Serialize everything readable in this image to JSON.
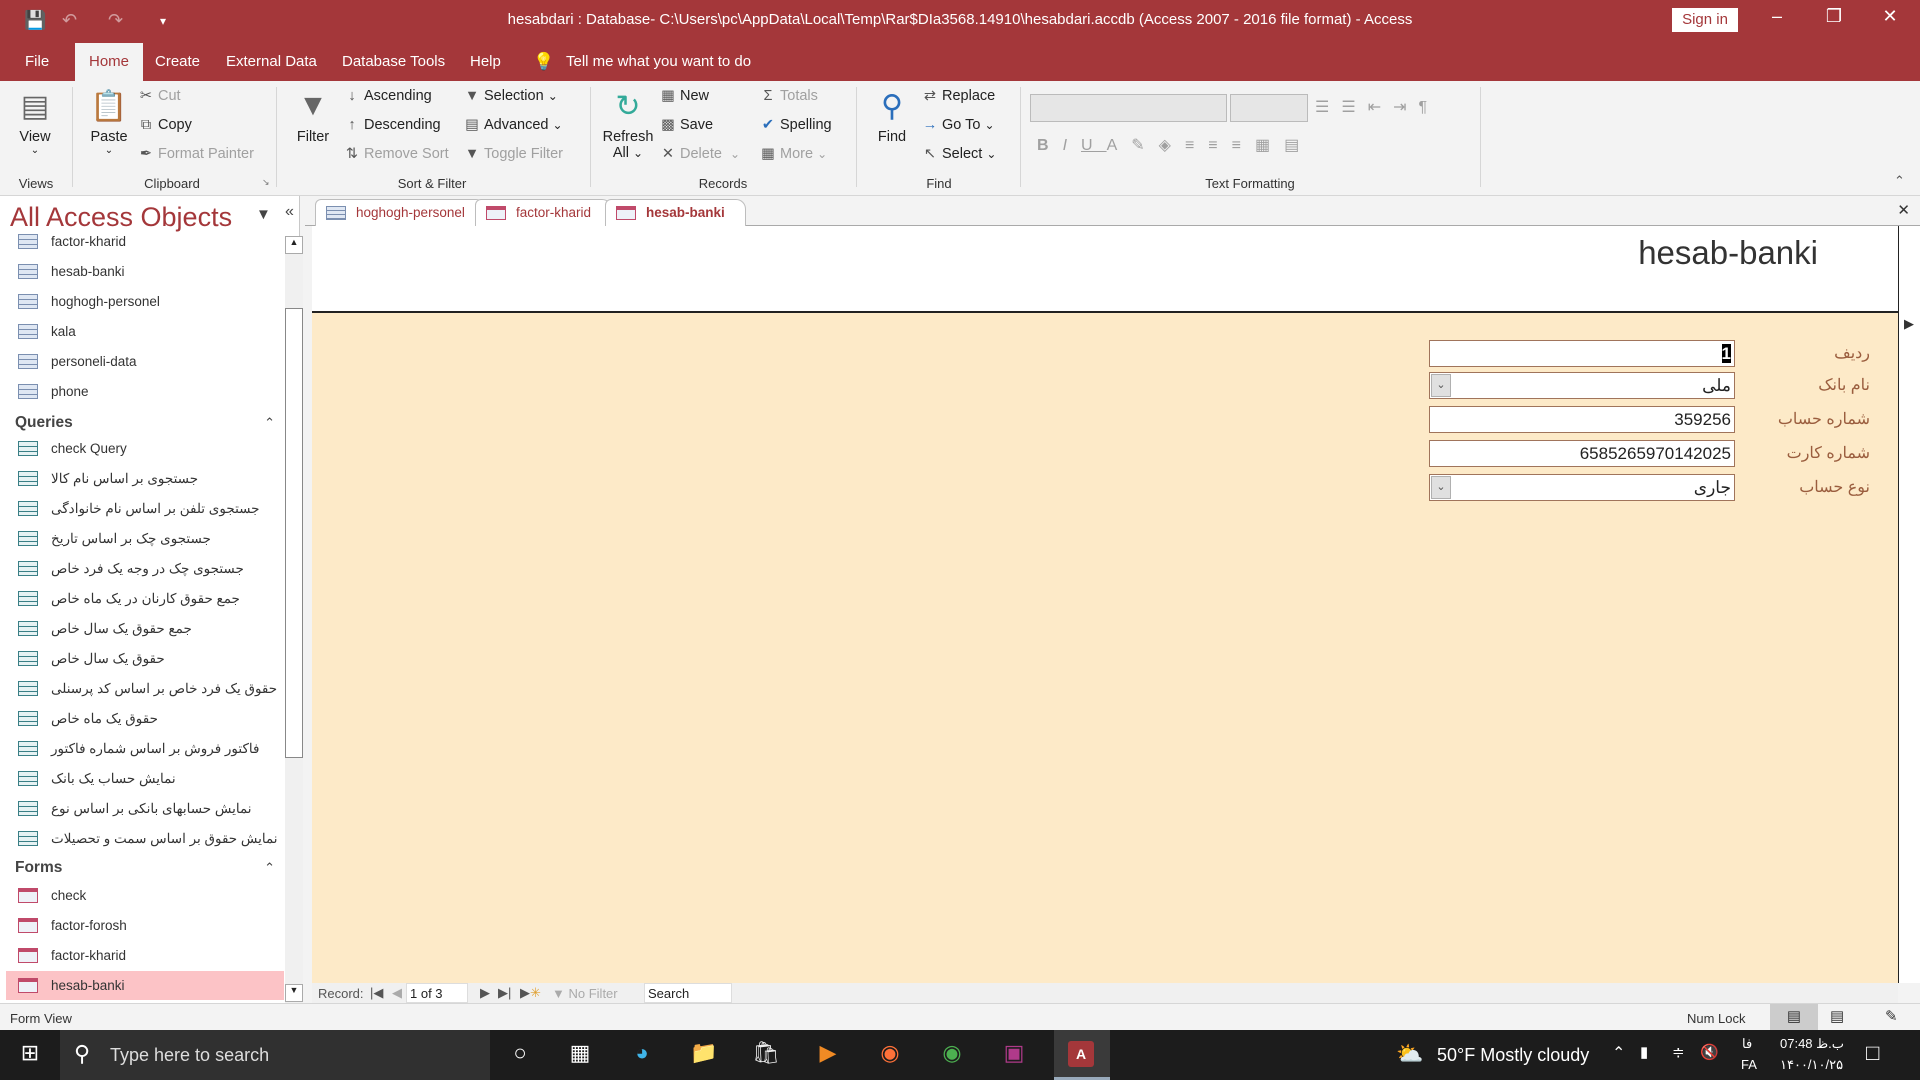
{
  "window": {
    "title": "hesabdari : Database- C:\\Users\\pc\\AppData\\Local\\Temp\\Rar$DIa3568.14910\\hesabdari.accdb (Access 2007 - 2016 file format)  -  Access",
    "sign_in": "Sign in",
    "accent": "#a4373a"
  },
  "menu": {
    "tabs": [
      "File",
      "Home",
      "Create",
      "External Data",
      "Database Tools",
      "Help"
    ],
    "tell_me": "Tell me what you want to do"
  },
  "ribbon": {
    "views": {
      "view": "View",
      "group": "Views"
    },
    "clipboard": {
      "paste": "Paste",
      "cut": "Cut",
      "copy": "Copy",
      "format_painter": "Format Painter",
      "group": "Clipboard"
    },
    "sort_filter": {
      "filter": "Filter",
      "ascending": "Ascending",
      "descending": "Descending",
      "remove_sort": "Remove Sort",
      "selection": "Selection",
      "advanced": "Advanced",
      "toggle_filter": "Toggle Filter",
      "group": "Sort & Filter"
    },
    "records": {
      "refresh": "Refresh",
      "refresh_all": "All",
      "new": "New",
      "save": "Save",
      "delete": "Delete",
      "totals": "Totals",
      "spelling": "Spelling",
      "more": "More",
      "group": "Records"
    },
    "find": {
      "find": "Find",
      "replace": "Replace",
      "goto": "Go To",
      "select": "Select",
      "group": "Find"
    },
    "text_formatting": {
      "group": "Text Formatting"
    }
  },
  "nav": {
    "title": "All Access Objects",
    "tables": [
      "factor-kharid",
      "hesab-banki",
      "hoghogh-personel",
      "kala",
      "personeli-data",
      "phone"
    ],
    "queries_label": "Queries",
    "queries": [
      "check Query",
      "جستجوی بر اساس نام کالا",
      "جستجوی تلفن بر اساس نام خانوادگی",
      "جستجوی چک بر اساس تاریخ",
      "جستجوی چک در وجه یک فرد خاص",
      "جمع حقوق کارنان در یک ماه خاص",
      "جمع حقوق یک سال خاص",
      "حقوق یک سال خاص",
      "حقوق یک فرد خاص بر اساس کد پرسنلی",
      "حقوق یک ماه خاص",
      "فاکتور فروش بر اساس شماره فاکتور",
      "نمایش حساب یک بانک",
      "نمایش حسابهای بانکی بر اساس نوع",
      "نمایش حقوق بر اساس سمت و تحصیلات"
    ],
    "forms_label": "Forms",
    "forms": [
      "check",
      "factor-forosh",
      "factor-kharid",
      "hesab-banki"
    ],
    "selected": "hesab-banki"
  },
  "doc_tabs": [
    "hoghogh-personel",
    "factor-kharid",
    "hesab-banki"
  ],
  "form": {
    "title": "hesab-banki",
    "fields": [
      {
        "label": "ردیف",
        "value": "1",
        "type": "text"
      },
      {
        "label": "نام بانک",
        "value": "ملی",
        "type": "combo"
      },
      {
        "label": "شماره حساب",
        "value": "359256",
        "type": "text"
      },
      {
        "label": "شماره کارت",
        "value": "6585265970142025",
        "type": "text"
      },
      {
        "label": "نوع حساب",
        "value": "جاری",
        "type": "combo"
      }
    ],
    "background": "#fdeac8"
  },
  "record_nav": {
    "label": "Record:",
    "position": "1 of 3",
    "filter": "No Filter",
    "search": "Search"
  },
  "status": {
    "left": "Form View",
    "num_lock": "Num Lock"
  },
  "taskbar": {
    "search_placeholder": "Type here to search",
    "weather": "50°F  Mostly cloudy",
    "lang_top": "فا",
    "lang": "FA",
    "time": "07:48 ب.ظ",
    "date": "۱۴۰۰/۱۰/۲۵"
  }
}
